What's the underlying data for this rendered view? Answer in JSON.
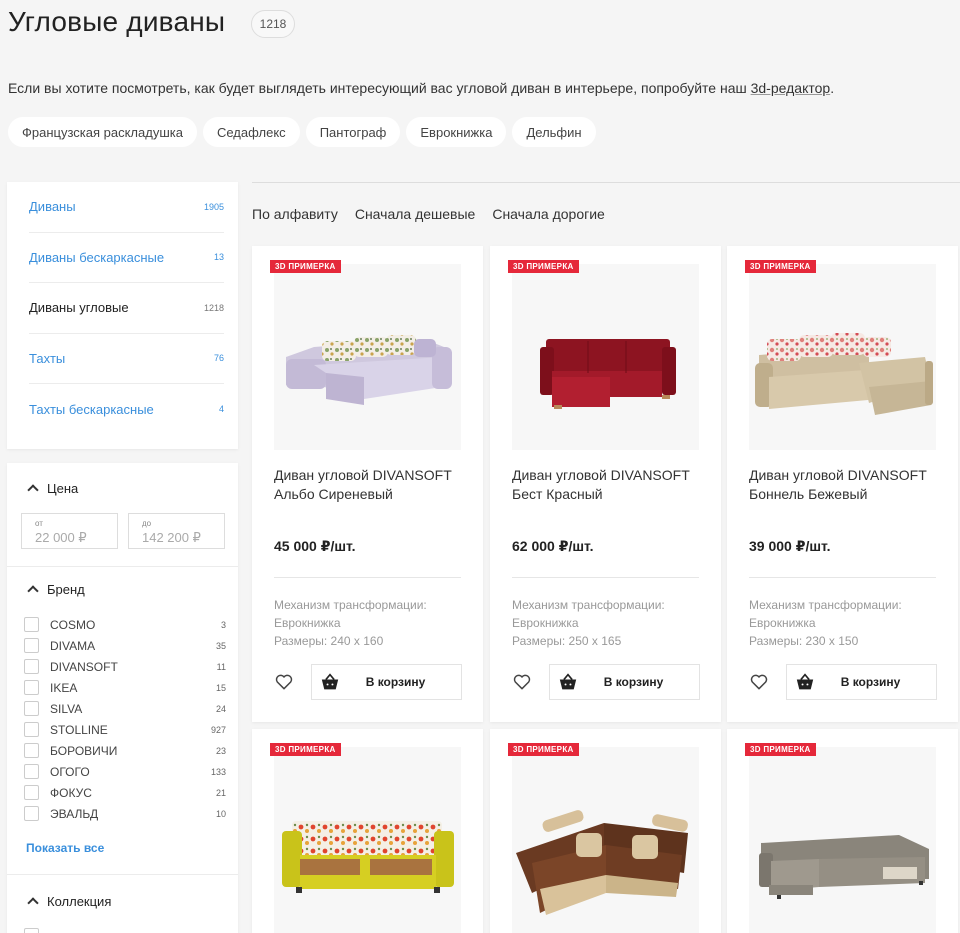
{
  "header": {
    "title": "Угловые диваны",
    "count": "1218"
  },
  "intro": {
    "text": "Если вы хотите посмотреть, как будет выглядеть интересующий вас угловой диван в интерьере, попробуйте наш ",
    "link": "3d-редактор",
    "after": "."
  },
  "chips": [
    "Французская раскладушка",
    "Седафлекс",
    "Пантограф",
    "Еврокнижка",
    "Дельфин"
  ],
  "categories": [
    {
      "label": "Диваны",
      "count": "1905"
    },
    {
      "label": "Диваны бескаркасные",
      "count": "13"
    },
    {
      "label": "Диваны угловые",
      "count": "1218"
    },
    {
      "label": "Тахты",
      "count": "76"
    },
    {
      "label": "Тахты бескаркасные",
      "count": "4"
    }
  ],
  "filters": {
    "price": {
      "title": "Цена",
      "from_label": "от",
      "from_placeholder": "22 000 ₽",
      "to_label": "до",
      "to_placeholder": "142 200 ₽"
    },
    "brand": {
      "title": "Бренд",
      "items": [
        {
          "name": "COSMO",
          "count": "3"
        },
        {
          "name": "DIVAMA",
          "count": "35"
        },
        {
          "name": "DIVANSOFT",
          "count": "11"
        },
        {
          "name": "IKEA",
          "count": "15"
        },
        {
          "name": "SILVA",
          "count": "24"
        },
        {
          "name": "STOLLINE",
          "count": "927"
        },
        {
          "name": "БОРОВИЧИ",
          "count": "23"
        },
        {
          "name": "ОГОГО",
          "count": "133"
        },
        {
          "name": "ФОКУС",
          "count": "21"
        },
        {
          "name": "ЭВАЛЬД",
          "count": "10"
        }
      ],
      "show_all": "Показать все"
    },
    "collection": {
      "title": "Коллекция"
    }
  },
  "sort": [
    "По алфавиту",
    "Сначала дешевые",
    "Сначала дорогие"
  ],
  "badge": "3D ПРИМЕРКА",
  "spec_label": "Механизм трансформации:",
  "cart_label": "В корзину",
  "products": [
    {
      "title": "Диван угловой DIVANSOFT Альбо Сиреневый",
      "price": "45 000 ₽/шт.",
      "mechanism": "Еврокнижка",
      "size": "Размеры: 240 x 160"
    },
    {
      "title": "Диван угловой DIVANSOFT Бест Красный",
      "price": "62 000 ₽/шт.",
      "mechanism": "Еврокнижка",
      "size": "Размеры: 250 x 165"
    },
    {
      "title": "Диван угловой DIVANSOFT Боннель Бежевый",
      "price": "39 000 ₽/шт.",
      "mechanism": "Еврокнижка",
      "size": "Размеры: 230 x 150"
    }
  ],
  "colors": {
    "accent": "#3a8fdc",
    "badge": "#e5283a"
  }
}
